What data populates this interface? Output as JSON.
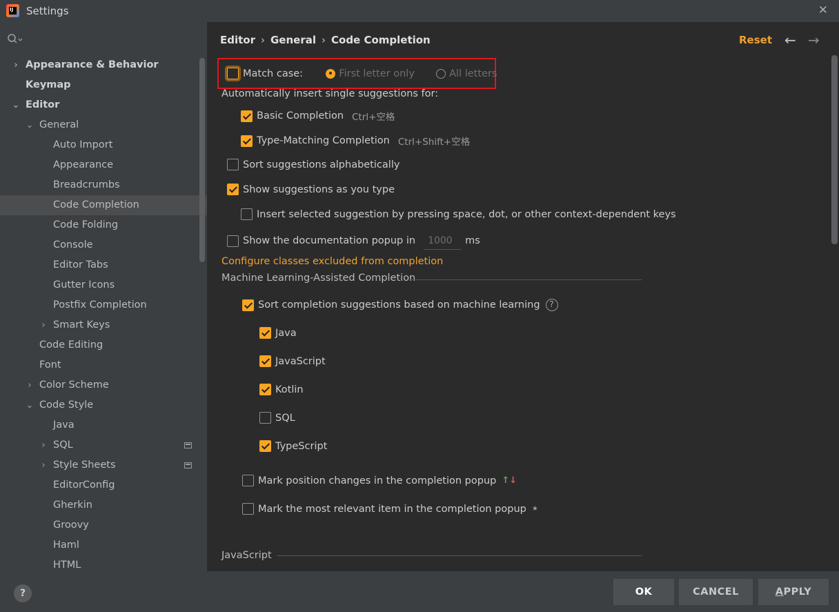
{
  "window": {
    "title": "Settings",
    "app_icon_text": "IJ"
  },
  "sidebar": {
    "items": [
      {
        "label": "Appearance & Behavior",
        "level": 0,
        "arrow": "›",
        "bold": true
      },
      {
        "label": "Keymap",
        "level": 0,
        "arrow": "",
        "bold": true
      },
      {
        "label": "Editor",
        "level": 0,
        "arrow": "⌄",
        "bold": true
      },
      {
        "label": "General",
        "level": 1,
        "arrow": "⌄"
      },
      {
        "label": "Auto Import",
        "level": 2,
        "arrow": ""
      },
      {
        "label": "Appearance",
        "level": 2,
        "arrow": ""
      },
      {
        "label": "Breadcrumbs",
        "level": 2,
        "arrow": ""
      },
      {
        "label": "Code Completion",
        "level": 2,
        "arrow": "",
        "selected": true
      },
      {
        "label": "Code Folding",
        "level": 2,
        "arrow": ""
      },
      {
        "label": "Console",
        "level": 2,
        "arrow": ""
      },
      {
        "label": "Editor Tabs",
        "level": 2,
        "arrow": ""
      },
      {
        "label": "Gutter Icons",
        "level": 2,
        "arrow": ""
      },
      {
        "label": "Postfix Completion",
        "level": 2,
        "arrow": ""
      },
      {
        "label": "Smart Keys",
        "level": 2,
        "arrow": "›"
      },
      {
        "label": "Code Editing",
        "level": 1,
        "arrow": ""
      },
      {
        "label": "Font",
        "level": 1,
        "arrow": ""
      },
      {
        "label": "Color Scheme",
        "level": 1,
        "arrow": "›"
      },
      {
        "label": "Code Style",
        "level": 1,
        "arrow": "⌄"
      },
      {
        "label": "Java",
        "level": 2,
        "arrow": ""
      },
      {
        "label": "SQL",
        "level": 2,
        "arrow": "›",
        "project_icon": true
      },
      {
        "label": "Style Sheets",
        "level": 2,
        "arrow": "›",
        "project_icon": true
      },
      {
        "label": "EditorConfig",
        "level": 2,
        "arrow": ""
      },
      {
        "label": "Gherkin",
        "level": 2,
        "arrow": ""
      },
      {
        "label": "Groovy",
        "level": 2,
        "arrow": ""
      },
      {
        "label": "Haml",
        "level": 2,
        "arrow": ""
      },
      {
        "label": "HTML",
        "level": 2,
        "arrow": ""
      }
    ]
  },
  "header": {
    "crumbs": [
      "Editor",
      "General",
      "Code Completion"
    ],
    "separator": "›",
    "reset_label": "Reset",
    "back_arrow": "←",
    "forward_arrow": "→"
  },
  "content": {
    "match_case": {
      "label": "Match case:",
      "checked": false,
      "options": [
        "First letter only",
        "All letters"
      ],
      "selected_option": "First letter only"
    },
    "auto_insert_label": "Automatically insert single suggestions for:",
    "basic_completion": {
      "label": "Basic Completion",
      "shortcut": "Ctrl+空格",
      "checked": true
    },
    "type_matching": {
      "label": "Type-Matching Completion",
      "shortcut": "Ctrl+Shift+空格",
      "checked": true
    },
    "sort_alpha": {
      "label": "Sort suggestions alphabetically",
      "checked": false
    },
    "show_as_type": {
      "label": "Show suggestions as you type",
      "checked": true
    },
    "insert_selected": {
      "label": "Insert selected suggestion by pressing space, dot, or other context-dependent keys",
      "checked": false
    },
    "doc_popup": {
      "label": "Show the documentation popup in",
      "value": "1000",
      "unit": "ms",
      "checked": false
    },
    "configure_link": "Configure classes excluded from completion",
    "ml_section_title": "Machine Learning-Assisted Completion",
    "ml_sort": {
      "label": "Sort completion suggestions based on machine learning",
      "checked": true
    },
    "ml_languages": [
      {
        "label": "Java",
        "checked": true
      },
      {
        "label": "JavaScript",
        "checked": true
      },
      {
        "label": "Kotlin",
        "checked": true
      },
      {
        "label": "SQL",
        "checked": false
      },
      {
        "label": "TypeScript",
        "checked": true
      }
    ],
    "mark_position": {
      "label": "Mark position changes in the completion popup",
      "checked": false
    },
    "mark_relevant": {
      "label": "Mark the most relevant item in the completion popup",
      "checked": false
    },
    "js_section_title": "JavaScript"
  },
  "footer": {
    "help_label": "?",
    "ok_label": "OK",
    "cancel_label": "CANCEL",
    "apply_label": "APPLY"
  },
  "colors": {
    "accent": "#f8a521",
    "highlight_box": "#e01818",
    "link": "#f0a030"
  }
}
